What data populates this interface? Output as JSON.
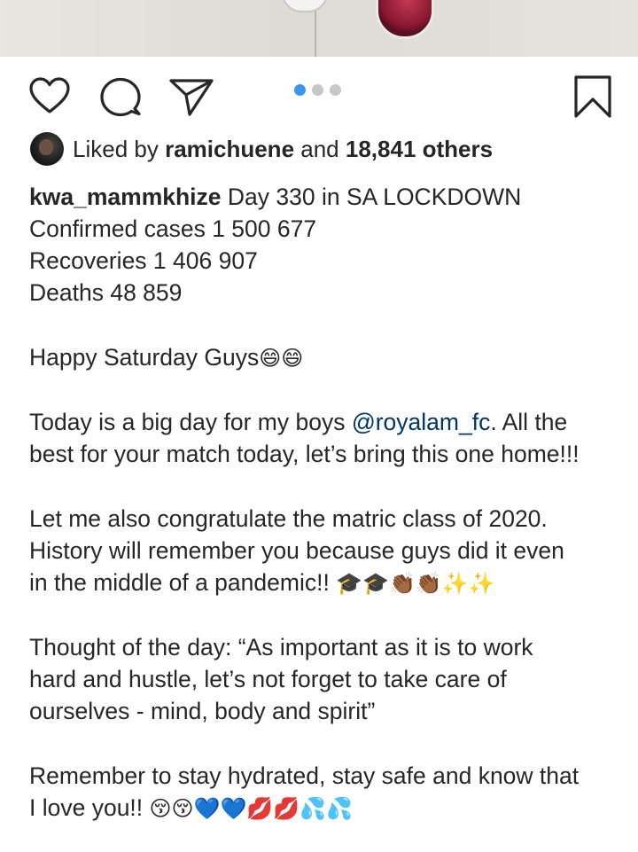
{
  "post": {
    "liked_by_prefix": "Liked by",
    "liked_by_user": "ramichuene",
    "liked_by_and": "and",
    "liked_by_count": "18,841 others",
    "carousel": {
      "total": 3,
      "active": 1
    },
    "caption": {
      "username": "kwa_mammkhize",
      "line1": "Day 330 in SA LOCKDOWN",
      "line2": "Confirmed cases 1 500 677",
      "line3": "Recoveries 1 406 907",
      "line4": "Deaths 48 859",
      "happy_text": "Happy Saturday Guys",
      "happy_emoji": "😄😄",
      "today_prefix": "Today is a big day for my boys ",
      "today_mention": "@royalam_fc",
      "today_suffix": ". All the",
      "today_line2": "best for your match today, let’s bring this one home!!!",
      "matric_line1": "Let me also congratulate the matric class of 2020.",
      "matric_line2": "History will remember you because guys did it even",
      "matric_line3": "in the middle of a pandemic!! ",
      "matric_emoji": "🎓🎓👏🏾👏🏾✨✨",
      "thought_line1": "Thought of the day: “As important as it is to work",
      "thought_line2": "hard and hustle, let’s not forget to take care of",
      "thought_line3": "ourselves - mind, body and spirit”",
      "remember_line1": "Remember to stay hydrated, stay safe and know that",
      "remember_line2": "I love you!! ",
      "remember_emoji": "😚😚💙💙💋💋💦💦"
    }
  },
  "icons": {
    "like": "heart-icon",
    "comment": "comment-icon",
    "share": "paper-plane-icon",
    "save": "bookmark-icon"
  },
  "colors": {
    "text": "#262626",
    "mention": "#003569",
    "carousel_active": "#3897f0",
    "carousel_inactive": "#c7c7c7"
  }
}
